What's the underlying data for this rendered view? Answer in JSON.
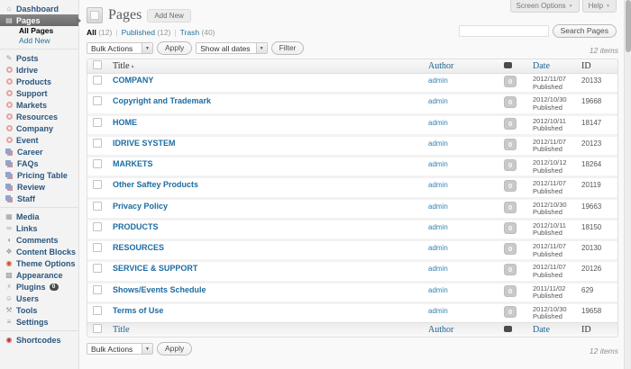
{
  "icons": {
    "caret_down": "▼",
    "sort_asc": "▴"
  },
  "admin_tabs": {
    "screen_options": "Screen Options",
    "help": "Help"
  },
  "header": {
    "title": "Pages",
    "add_new": "Add New"
  },
  "search": {
    "value": "",
    "button": "Search Pages"
  },
  "filters": {
    "all_label": "All",
    "all_count": "(12)",
    "published_label": "Published",
    "published_count": "(12)",
    "trash_label": "Trash",
    "trash_count": "(40)"
  },
  "toolbar": {
    "bulk_actions": "Bulk Actions",
    "apply": "Apply",
    "dates_filter": "Show all dates",
    "filter": "Filter",
    "items_count": "12 items"
  },
  "sidebar": {
    "items": [
      {
        "slug": "dashboard",
        "label": "Dashboard",
        "icon": "dashboard"
      },
      {
        "slug": "pages",
        "label": "Pages",
        "icon": "pages",
        "active": true,
        "submenu": [
          {
            "slug": "all-pages",
            "label": "All Pages",
            "current": true
          },
          {
            "slug": "add-new",
            "label": "Add New"
          }
        ]
      },
      {
        "separator": true
      },
      {
        "slug": "posts",
        "label": "Posts",
        "icon": "posts"
      },
      {
        "slug": "idrive",
        "label": "Idrive",
        "icon": "ring"
      },
      {
        "slug": "products",
        "label": "Products",
        "icon": "ring"
      },
      {
        "slug": "support",
        "label": "Support",
        "icon": "ring"
      },
      {
        "slug": "markets",
        "label": "Markets",
        "icon": "ring"
      },
      {
        "slug": "resources",
        "label": "Resources",
        "icon": "ring"
      },
      {
        "slug": "company",
        "label": "Company",
        "icon": "ring"
      },
      {
        "slug": "event",
        "label": "Event",
        "icon": "ring"
      },
      {
        "slug": "career",
        "label": "Career",
        "icon": "layers"
      },
      {
        "slug": "faqs",
        "label": "FAQs",
        "icon": "layers"
      },
      {
        "slug": "pricing-table",
        "label": "Pricing Table",
        "icon": "layers"
      },
      {
        "slug": "review",
        "label": "Review",
        "icon": "layers"
      },
      {
        "slug": "staff",
        "label": "Staff",
        "icon": "layers"
      },
      {
        "separator": true
      },
      {
        "slug": "media",
        "label": "Media",
        "icon": "media"
      },
      {
        "slug": "links",
        "label": "Links",
        "icon": "links"
      },
      {
        "slug": "comments",
        "label": "Comments",
        "icon": "comments"
      },
      {
        "slug": "content-blocks",
        "label": "Content Blocks",
        "icon": "content-blocks"
      },
      {
        "slug": "theme-options",
        "label": "Theme Options",
        "icon": "theme-options"
      },
      {
        "slug": "appearance",
        "label": "Appearance",
        "icon": "appearance"
      },
      {
        "slug": "plugins",
        "label": "Plugins",
        "icon": "plugins",
        "badge": "0"
      },
      {
        "slug": "users",
        "label": "Users",
        "icon": "users"
      },
      {
        "slug": "tools",
        "label": "Tools",
        "icon": "tools"
      },
      {
        "slug": "settings",
        "label": "Settings",
        "icon": "settings"
      },
      {
        "separator": true
      },
      {
        "slug": "shortcodes",
        "label": "Shortcodes",
        "icon": "shortcodes"
      }
    ]
  },
  "table": {
    "headers": {
      "title": "Title",
      "author": "Author",
      "date": "Date",
      "id": "ID"
    },
    "rows": [
      {
        "title": "COMPANY",
        "author": "admin",
        "comments": "0",
        "date": "2012/11/07",
        "status": "Published",
        "id": "20133"
      },
      {
        "title": "Copyright and Trademark",
        "author": "admin",
        "comments": "0",
        "date": "2012/10/30",
        "status": "Published",
        "id": "19668"
      },
      {
        "title": "HOME",
        "author": "admin",
        "comments": "0",
        "date": "2012/10/11",
        "status": "Published",
        "id": "18147"
      },
      {
        "title": "IDRIVE SYSTEM",
        "author": "admin",
        "comments": "0",
        "date": "2012/11/07",
        "status": "Published",
        "id": "20123"
      },
      {
        "title": "MARKETS",
        "author": "admin",
        "comments": "0",
        "date": "2012/10/12",
        "status": "Published",
        "id": "18264"
      },
      {
        "title": "Other Saftey Products",
        "author": "admin",
        "comments": "0",
        "date": "2012/11/07",
        "status": "Published",
        "id": "20119"
      },
      {
        "title": "Privacy Policy",
        "author": "admin",
        "comments": "0",
        "date": "2012/10/30",
        "status": "Published",
        "id": "19663"
      },
      {
        "title": "PRODUCTS",
        "author": "admin",
        "comments": "0",
        "date": "2012/10/11",
        "status": "Published",
        "id": "18150"
      },
      {
        "title": "RESOURCES",
        "author": "admin",
        "comments": "0",
        "date": "2012/11/07",
        "status": "Published",
        "id": "20130"
      },
      {
        "title": "SERVICE & SUPPORT",
        "author": "admin",
        "comments": "0",
        "date": "2012/11/07",
        "status": "Published",
        "id": "20126"
      },
      {
        "title": "Shows/Events Schedule",
        "author": "admin",
        "comments": "0",
        "date": "2011/11/02",
        "status": "Published",
        "id": "629"
      },
      {
        "title": "Terms of Use",
        "author": "admin",
        "comments": "0",
        "date": "2012/10/30",
        "status": "Published",
        "id": "19658"
      }
    ]
  }
}
